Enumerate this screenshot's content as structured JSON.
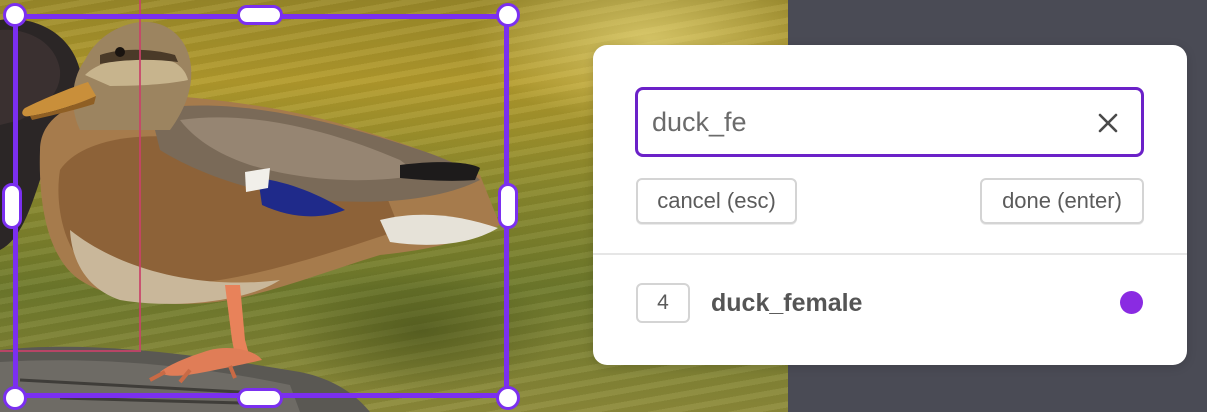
{
  "label_popup": {
    "input": {
      "value": "duck_fe",
      "placeholder": ""
    },
    "clear_icon": "close-x-icon",
    "cancel_label": "cancel (esc)",
    "done_label": "done (enter)",
    "options": [
      {
        "hotkey": "4",
        "label": "duck_female",
        "color": "#8a2be2"
      }
    ]
  },
  "colors": {
    "selection_accent": "#7b2ff0",
    "input_border": "#6b21c8",
    "previous_box": "#c9426a",
    "canvas_background": "#4a4b55"
  }
}
